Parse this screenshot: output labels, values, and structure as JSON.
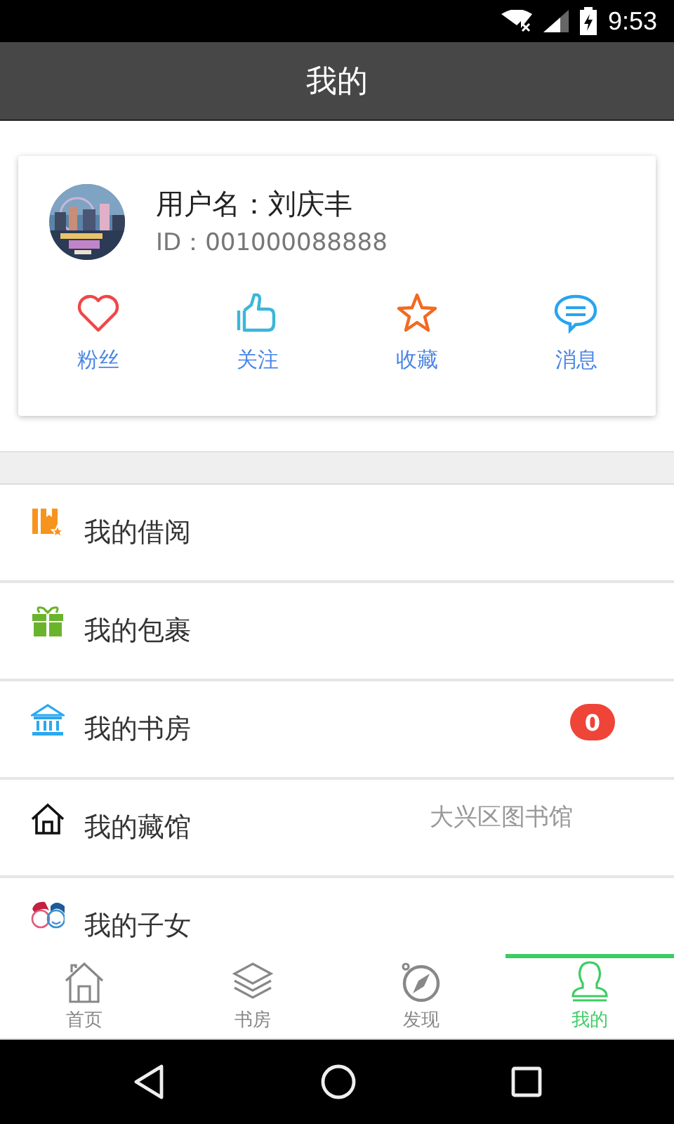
{
  "status_bar": {
    "time": "9:53"
  },
  "title": "我的",
  "profile": {
    "username": "用户名：刘庆丰",
    "id": "ID：001000088888",
    "actions": [
      {
        "label": "粉丝",
        "kind": "heart"
      },
      {
        "label": "关注",
        "kind": "thumb"
      },
      {
        "label": "收藏",
        "kind": "star"
      },
      {
        "label": "消息",
        "kind": "chat"
      }
    ]
  },
  "menu": [
    {
      "label": "我的借阅",
      "kind": "books"
    },
    {
      "label": "我的包裹",
      "kind": "gift"
    },
    {
      "label": "我的书房",
      "kind": "library",
      "badge": "0"
    },
    {
      "label": "我的藏馆",
      "kind": "house",
      "value": "大兴区图书馆"
    },
    {
      "label": "我的子女",
      "kind": "kids"
    }
  ],
  "tabs": [
    {
      "label": "首页",
      "kind": "home",
      "selected": false
    },
    {
      "label": "书房",
      "kind": "layers",
      "selected": false
    },
    {
      "label": "发现",
      "kind": "compass",
      "selected": false
    },
    {
      "label": "我的",
      "kind": "person",
      "selected": true
    }
  ]
}
